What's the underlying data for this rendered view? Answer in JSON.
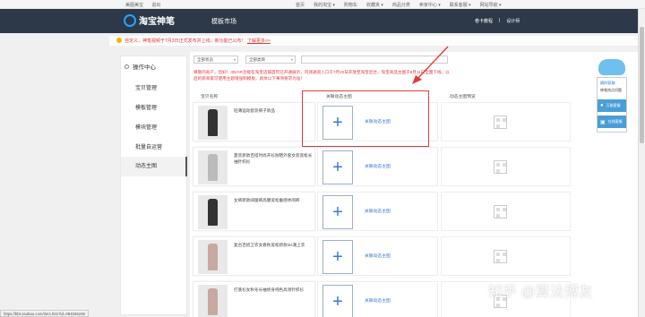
{
  "topbar": {
    "left": [
      "美图美宝",
      "退出"
    ],
    "right": [
      "首页",
      "我的淘宝 ▾",
      "购物车",
      "收藏夹 ▾",
      "商品分类",
      "卖家中心 ▾",
      "联系客服 ▾",
      "网站导航 ▾"
    ]
  },
  "header": {
    "logo_text": "淘宝神笔",
    "market": "模板市场",
    "links": [
      "卷卡教程",
      "|",
      "设计师"
    ]
  },
  "notice": {
    "text": "自定义，神笔视频于7月3日正式发布并上线，新功能已公布！",
    "link": "了解更多>>"
  },
  "sidebar": {
    "head": "操作中心",
    "items": [
      "宝贝管理",
      "模板管理",
      "模块管理",
      "批量自运营",
      "动态主图"
    ],
    "active_index": 4
  },
  "filters": {
    "select1": "全部状态",
    "select2": "全部类目"
  },
  "description": "尊敬的商户，您好！3D/AR功能在淘宝店铺首页已开通展示，内测通道入口于7月20日开放至淘宝后台，淘宝商品主图于8月11日全面下线，以后的新商家可使用主题增强制模板，具体以下事项要求为准！",
  "columns": [
    "宝贝名称",
    "关联动态主图",
    "动态主图预览"
  ],
  "rows": [
    {
      "title": "轻薄运动套装裤子新品",
      "add_label": "关联动态主图"
    },
    {
      "title": "夏装新款百搭时尚开衫防晒外套女装宽松长袖针织衫",
      "add_label": "关联动态主图"
    },
    {
      "title": "女裤新款阔腿裤高腰宽松垂感休闲裤",
      "add_label": "关联动态主图"
    },
    {
      "title": "复古百搭卫衣女春秋宽松新款ins潮上衣",
      "add_label": "关联动态主图"
    },
    {
      "title": "打底衫女秋冬长袖修身纯色高领针织衫",
      "add_label": "关联动态主图"
    }
  ],
  "widget": {
    "title": "随时获取",
    "subtitle": "神笔热点问题",
    "btn1": "万能客服",
    "btn2": "在线客服"
  },
  "watermark": "知乎 @算法博友",
  "statusbar": "https://bbs.taobao.com/item.htm?id=394565245"
}
